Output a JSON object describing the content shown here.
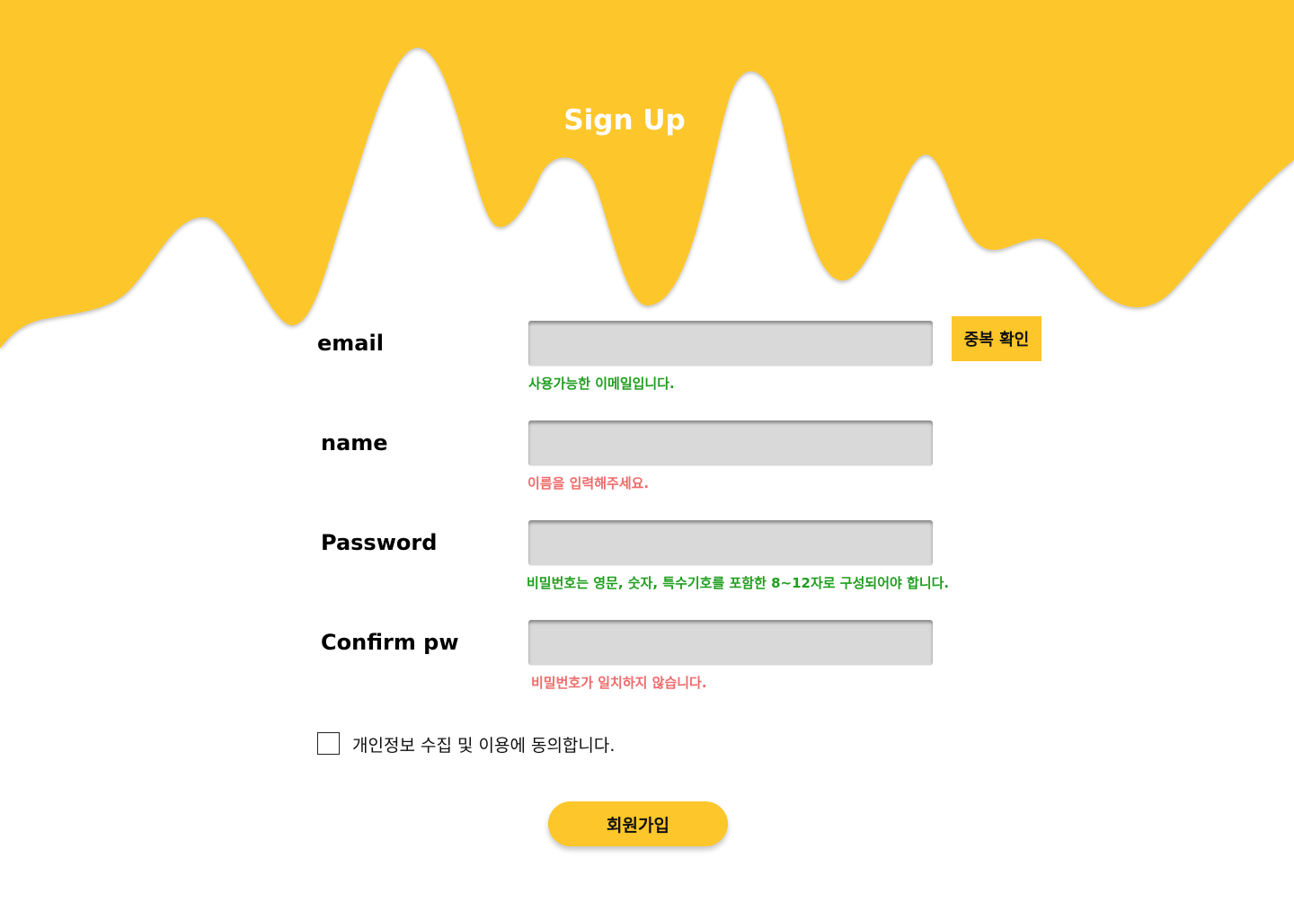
{
  "header": {
    "title": "Sign Up",
    "accent_color": "#FDC62A"
  },
  "form": {
    "email": {
      "label": "email",
      "value": "",
      "message": "사용가능한 이메일입니다.",
      "message_status": "success"
    },
    "duplicate_check_button": "중복 확인",
    "name": {
      "label": "name",
      "value": "",
      "message": "이름을 입력해주세요.",
      "message_status": "error"
    },
    "password": {
      "label": "Password",
      "value": "",
      "message": "비밀번호는 영문, 숫자, 특수기호를 포함한 8~12자로 구성되어야 합니다.",
      "message_status": "success"
    },
    "confirm_password": {
      "label": "Confirm pw",
      "value": "",
      "message": "비밀번호가 일치하지 않습니다.",
      "message_status": "error"
    },
    "consent": {
      "label": "개인정보 수집 및 이용에 동의합니다.",
      "checked": false
    },
    "submit_button": "회원가입"
  },
  "colors": {
    "accent": "#FDC62A",
    "success": "#1F9E1F",
    "error": "#EE6B6B",
    "input_background": "#D9D9D9"
  }
}
